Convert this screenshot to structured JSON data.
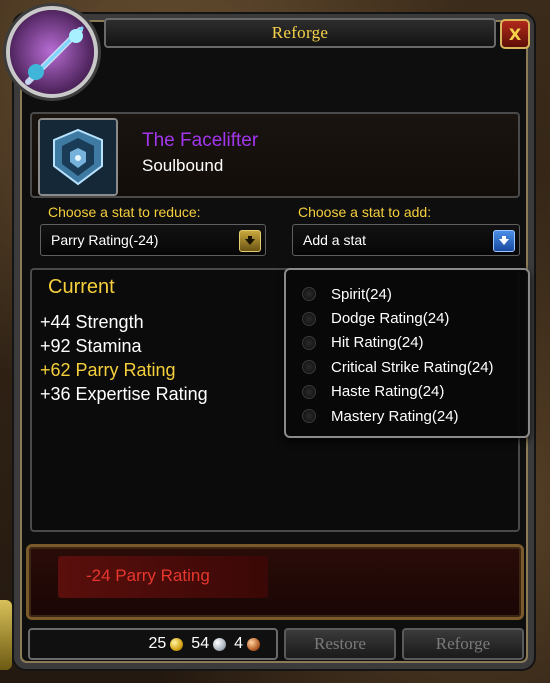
{
  "window": {
    "title": "Reforge",
    "close_label": "X"
  },
  "item": {
    "name": "The Facelifter",
    "binding": "Soulbound",
    "name_color": "#a335ee"
  },
  "reduce": {
    "label": "Choose a stat to reduce:",
    "selected": "Parry Rating(-24)"
  },
  "add": {
    "label": "Choose a stat to add:",
    "selected": "Add a stat"
  },
  "current": {
    "title": "Current",
    "stats": [
      {
        "text": "+44 Strength",
        "highlight": false
      },
      {
        "text": "+92 Stamina",
        "highlight": false
      },
      {
        "text": "+62 Parry Rating",
        "highlight": true
      },
      {
        "text": "+36 Expertise Rating",
        "highlight": false
      }
    ]
  },
  "add_options": [
    "Spirit(24)",
    "Dodge Rating(24)",
    "Hit Rating(24)",
    "Critical Strike Rating(24)",
    "Haste Rating(24)",
    "Mastery Rating(24)"
  ],
  "result": {
    "text": "-24 Parry Rating",
    "color": "#e7372d"
  },
  "money": {
    "gold": "25",
    "silver": "54",
    "copper": "4"
  },
  "buttons": {
    "restore": "Restore",
    "reforge": "Reforge"
  },
  "icons": {
    "close": "close-icon",
    "reduce_dropdown": "chevron-down-icon",
    "add_dropdown": "chevron-down-icon",
    "gold": "gold-coin-icon",
    "silver": "silver-coin-icon",
    "copper": "copper-coin-icon"
  }
}
